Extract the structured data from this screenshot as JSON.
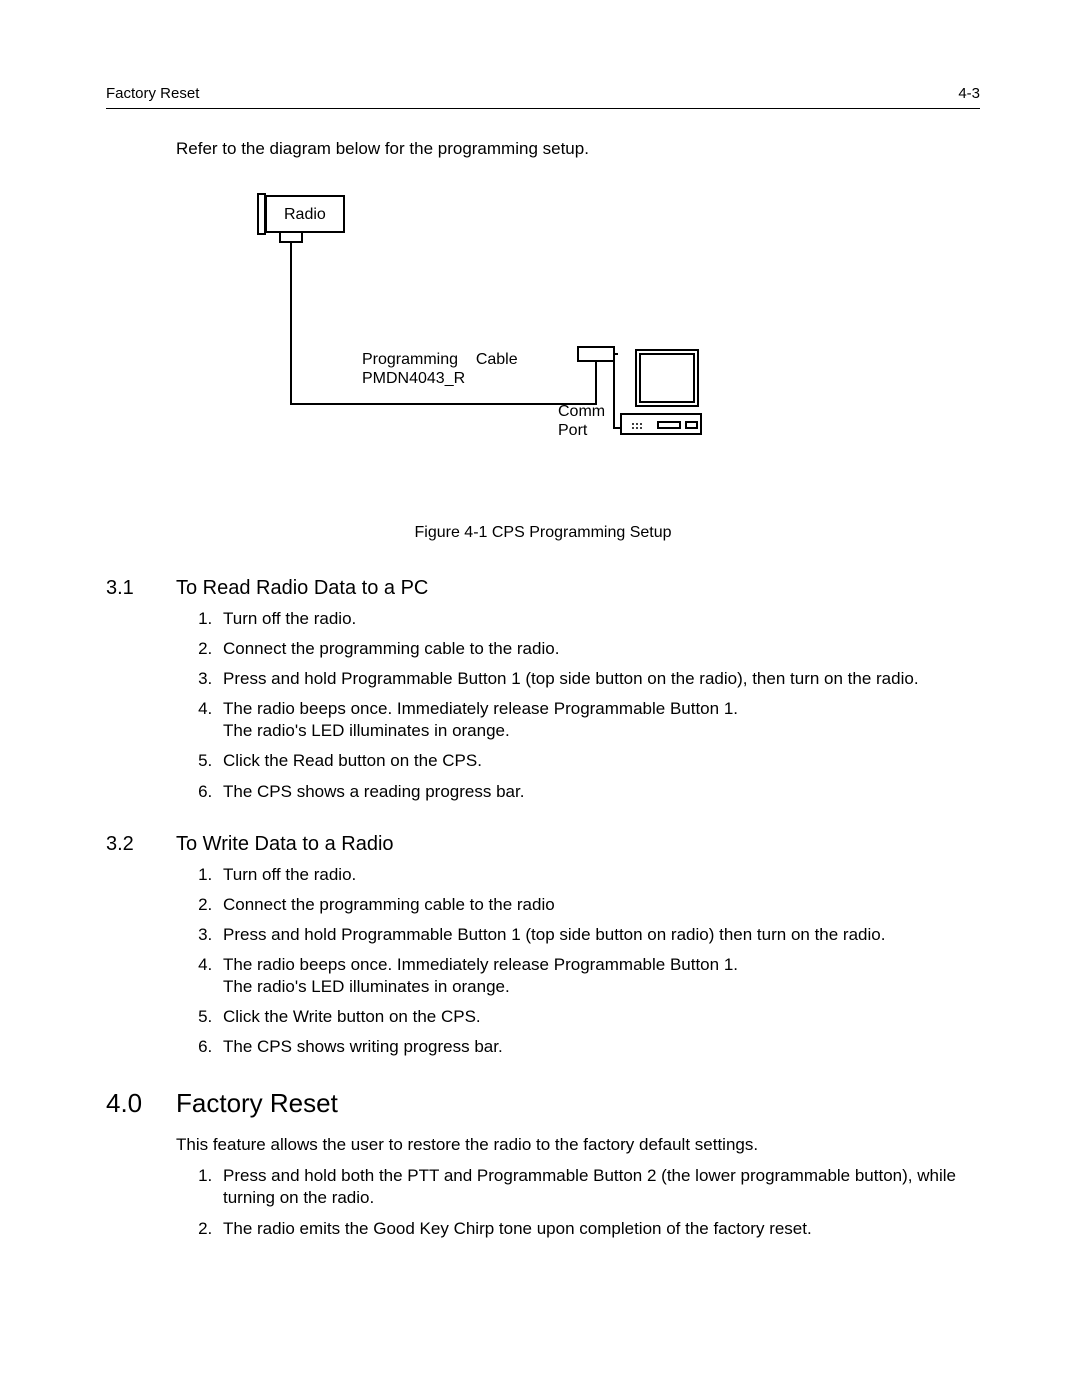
{
  "header": {
    "left": "Factory Reset",
    "right": "4-3"
  },
  "intro": "Refer to the diagram below for the programming setup.",
  "diagram": {
    "radio_label": "Radio",
    "prog_cable_line1": "Programming    Cable",
    "prog_cable_line2": "PMDN4043_R",
    "comm_line1": "Comm",
    "comm_line2": "Port"
  },
  "figure_caption": "Figure 4-1 CPS Programming Setup",
  "section31": {
    "num": "3.1",
    "title": "To Read Radio Data to a PC",
    "steps": [
      "Turn off the radio.",
      "Connect the programming cable to the radio.",
      "Press and hold Programmable Button 1 (top side button on the radio), then turn on the radio.",
      "The radio beeps once. Immediately release Programmable Button 1.\nThe radio's LED illuminates in orange.",
      "Click the Read button on the CPS.",
      "The CPS shows a reading progress bar."
    ]
  },
  "section32": {
    "num": "3.2",
    "title": "To Write Data to a Radio",
    "steps": [
      "Turn off the radio.",
      "Connect the programming cable to the radio",
      "Press and hold Programmable Button 1 (top side button on radio) then turn on the radio.",
      "The radio beeps once. Immediately release Programmable Button 1.\nThe radio's LED illuminates in orange.",
      "Click the Write button on the CPS.",
      "The CPS shows writing progress bar."
    ]
  },
  "section40": {
    "num": "4.0",
    "title": "Factory Reset",
    "body": "This feature allows the user to restore the radio to the factory default settings.",
    "steps": [
      "Press and hold both the PTT and Programmable Button 2 (the lower programmable button), while turning on the radio.",
      "The radio emits the Good Key Chirp tone upon completion of the factory reset."
    ]
  }
}
